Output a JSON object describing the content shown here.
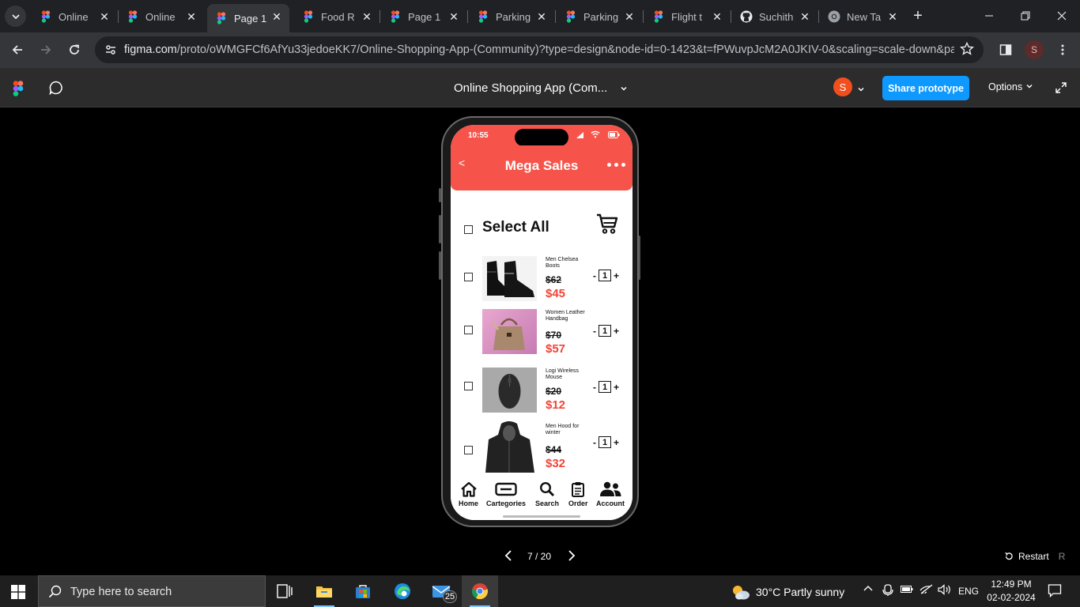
{
  "browser": {
    "tabs": [
      {
        "title": "Online",
        "icon": "figma-icon"
      },
      {
        "title": "Online",
        "icon": "figma-icon"
      },
      {
        "title": "Page 1",
        "icon": "figma-icon",
        "active": true
      },
      {
        "title": "Food R",
        "icon": "figma-icon"
      },
      {
        "title": "Page 1",
        "icon": "figma-icon"
      },
      {
        "title": "Parking",
        "icon": "figma-icon"
      },
      {
        "title": "Parking",
        "icon": "figma-icon"
      },
      {
        "title": "Flight t",
        "icon": "figma-icon"
      },
      {
        "title": "Suchith",
        "icon": "github-icon"
      },
      {
        "title": "New Ta",
        "icon": "chrome-icon"
      }
    ],
    "url_host": "figma.com",
    "url_path": "/proto/oWMGFCf6AfYu33jedoeKK7/Online-Shopping-App-(Community)?type=design&node-id=0-1423&t=fPWuvpJcM2A0JKIV-0&scaling=scale-down&pag...",
    "profile_initial": "S"
  },
  "figma": {
    "file_title": "Online Shopping App (Com...",
    "avatar_initial": "S",
    "share_label": "Share prototype",
    "options_label": "Options",
    "pager": "7 / 20",
    "restart_label": "Restart",
    "restart_key": "R",
    "accent": "#0d99ff"
  },
  "app": {
    "status_time": "10:55",
    "title": "Mega Sales",
    "select_all": "Select All",
    "accent": "#f6544a",
    "items": [
      {
        "name": "Men Chelsea Boots",
        "old_price": "$62",
        "new_price": "$45",
        "qty": "1"
      },
      {
        "name": "Women Leather Handbag",
        "old_price": "$70",
        "new_price": "$57",
        "qty": "1"
      },
      {
        "name": "Logi Wireless Mouse",
        "old_price": "$20",
        "new_price": "$12",
        "qty": "1"
      },
      {
        "name": "Men Hood for winter",
        "old_price": "$44",
        "new_price": "$32",
        "qty": "1"
      }
    ],
    "qty_minus": "-",
    "qty_plus": "+",
    "tabbar": [
      "Home",
      "Cartegories",
      "Search",
      "Order",
      "Account"
    ]
  },
  "taskbar": {
    "search_placeholder": "Type here to search",
    "mail_badge": "25",
    "weather": "30°C  Partly sunny",
    "lang": "ENG",
    "time": "12:49 PM",
    "date": "02-02-2024"
  }
}
